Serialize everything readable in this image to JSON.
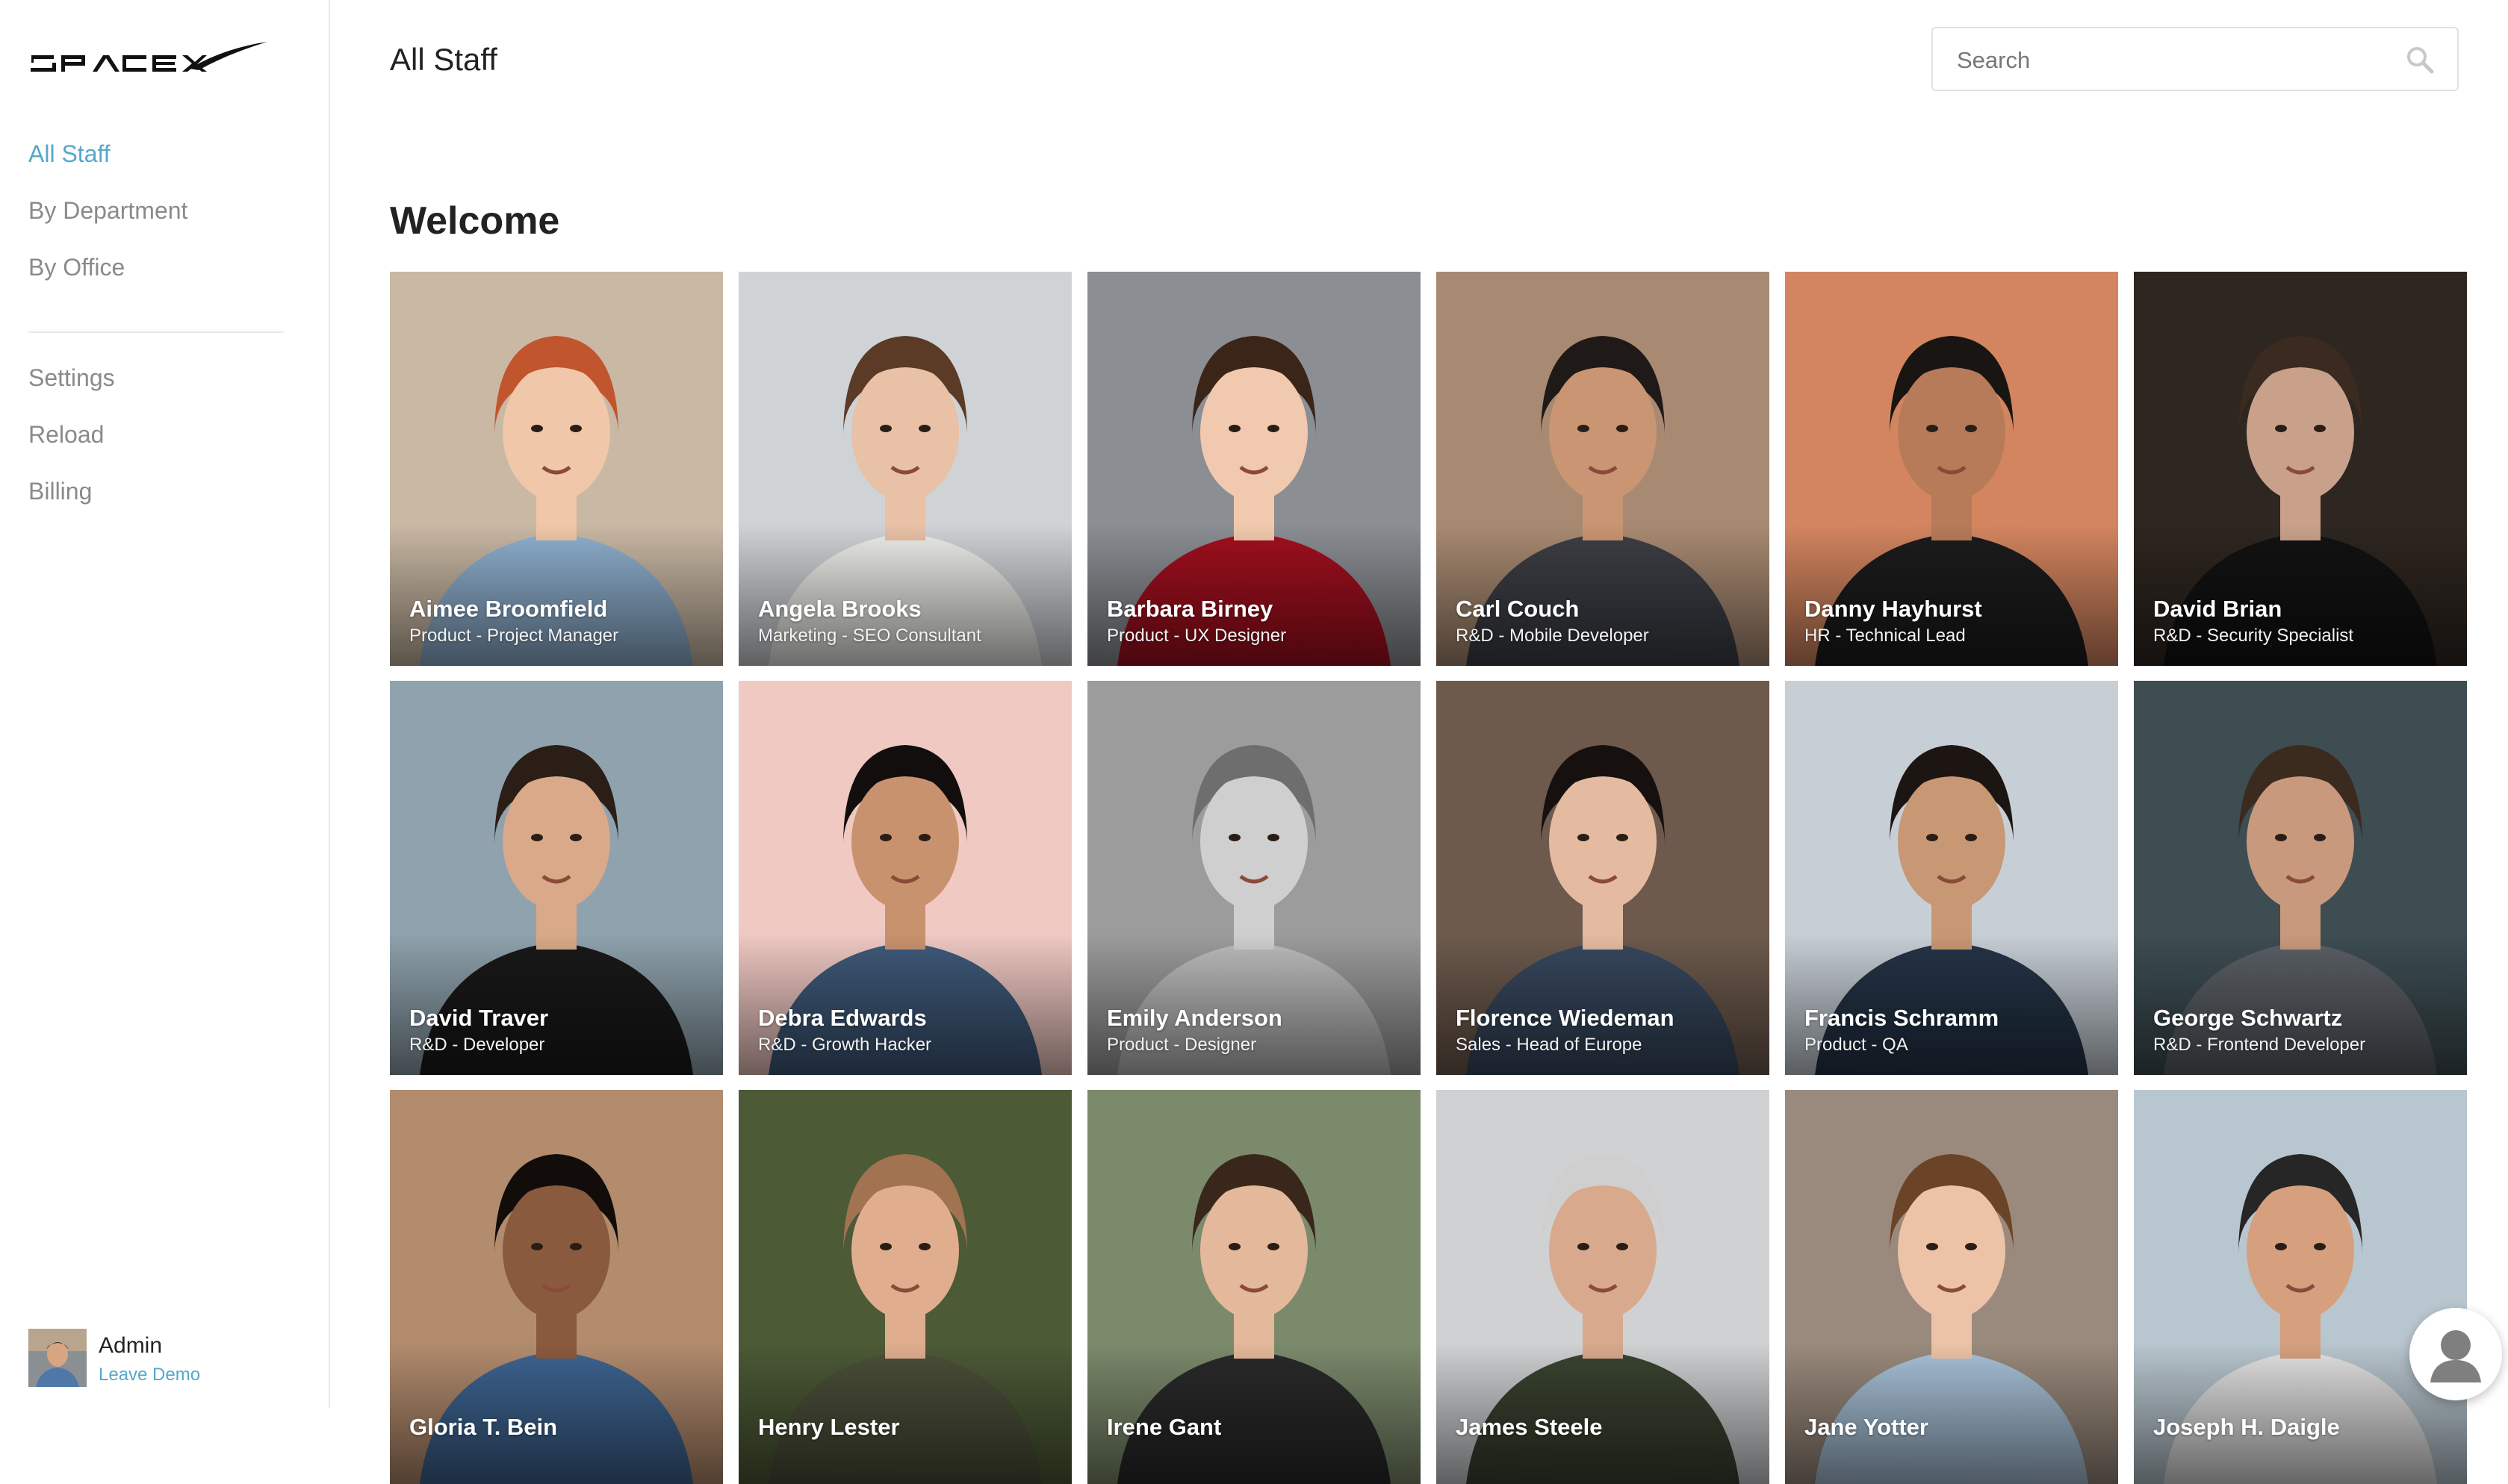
{
  "brand": {
    "logo_text": "SPACEX",
    "logo_icon": "spacex-logo"
  },
  "sidebar": {
    "primary": [
      {
        "label": "All Staff",
        "active": true
      },
      {
        "label": "By Department",
        "active": false
      },
      {
        "label": "By Office",
        "active": false
      }
    ],
    "secondary": [
      {
        "label": "Settings"
      },
      {
        "label": "Reload"
      },
      {
        "label": "Billing"
      }
    ],
    "user": {
      "name": "Admin",
      "action": "Leave Demo"
    }
  },
  "header": {
    "title": "All Staff",
    "search": {
      "placeholder": "Search",
      "value": "",
      "icon": "search-icon"
    }
  },
  "main": {
    "heading": "Welcome",
    "staff": [
      {
        "name": "Aimee Broomfield",
        "role": "Product - Project Manager",
        "bg": "#c9b8a4",
        "skin": "#f0c7a8",
        "hair": "#c0552e",
        "shirt": "#8fb1d0"
      },
      {
        "name": "Angela Brooks",
        "role": "Marketing - SEO Consultant",
        "bg": "#cfd3d6",
        "skin": "#e8c1a6",
        "hair": "#5b3a26",
        "shirt": "#eeeeea"
      },
      {
        "name": "Barbara Birney",
        "role": "Product - UX Designer",
        "bg": "#8b8e93",
        "skin": "#f1c9ae",
        "hair": "#3b2418",
        "shirt": "#a30f1e"
      },
      {
        "name": "Carl Couch",
        "role": "R&D - Mobile Developer",
        "bg": "#a88a72",
        "skin": "#c99573",
        "hair": "#1f1a17",
        "shirt": "#3d3f46"
      },
      {
        "name": "Danny Hayhurst",
        "role": "HR - Technical Lead",
        "bg": "#d3855f",
        "skin": "#b77b5a",
        "hair": "#181513",
        "shirt": "#1c1c1c"
      },
      {
        "name": "David Brian",
        "role": "R&D - Security Specialist",
        "bg": "#2e2620",
        "skin": "#c9a18a",
        "hair": "#3a2a1f",
        "shirt": "#121212"
      },
      {
        "name": "David Traver",
        "role": "R&D - Developer",
        "bg": "#8fa2ad",
        "skin": "#d9a98a",
        "hair": "#2a1e17",
        "shirt": "#191919"
      },
      {
        "name": "Debra Edwards",
        "role": "R&D - Growth Hacker",
        "bg": "#f0c9c3",
        "skin": "#c9926e",
        "hair": "#120e0d",
        "shirt": "#3f5a7a"
      },
      {
        "name": "Emily Anderson",
        "role": "Product - Designer",
        "bg": "#9c9c9c",
        "skin": "#cfcfcf",
        "hair": "#6e6e6e",
        "shirt": "#bdbdbd"
      },
      {
        "name": "Florence Wiedeman",
        "role": "Sales - Head of Europe",
        "bg": "#6d5a4d",
        "skin": "#e4bba0",
        "hair": "#16110f",
        "shirt": "#37485e"
      },
      {
        "name": "Francis Schramm",
        "role": "Product - QA",
        "bg": "#c7cfd6",
        "skin": "#c79873",
        "hair": "#1d1512",
        "shirt": "#243447"
      },
      {
        "name": "George Schwartz",
        "role": "R&D - Frontend Developer",
        "bg": "#3d4d52",
        "skin": "#c9997d",
        "hair": "#3b2a1e",
        "shirt": "#5b6066"
      },
      {
        "name": "Gloria T. Bein",
        "role": "",
        "bg": "#b38c6e",
        "skin": "#8a5a3f",
        "hair": "#120d0b",
        "shirt": "#3e6592"
      },
      {
        "name": "Henry Lester",
        "role": "",
        "bg": "#4c5a36",
        "skin": "#e0ae8f",
        "hair": "#a27350",
        "shirt": "#4c4f3a"
      },
      {
        "name": "Irene Gant",
        "role": "",
        "bg": "#7c8a6c",
        "skin": "#e4b89a",
        "hair": "#3a271c",
        "shirt": "#2a2a2a"
      },
      {
        "name": "James Steele",
        "role": "",
        "bg": "#cfd1d3",
        "skin": "#d8a98d",
        "hair": "#cfcfcf",
        "shirt": "#3a4331"
      },
      {
        "name": "Jane Yotter",
        "role": "",
        "bg": "#9a8a7d",
        "skin": "#ecc3a6",
        "hair": "#6b4428",
        "shirt": "#a9c3d9"
      },
      {
        "name": "Joseph H. Daigle",
        "role": "",
        "bg": "#b8c6cf",
        "skin": "#d6a07f",
        "hair": "#262626",
        "shirt": "#e2e2e2"
      }
    ]
  },
  "chat_button": {
    "icon": "person-icon"
  }
}
